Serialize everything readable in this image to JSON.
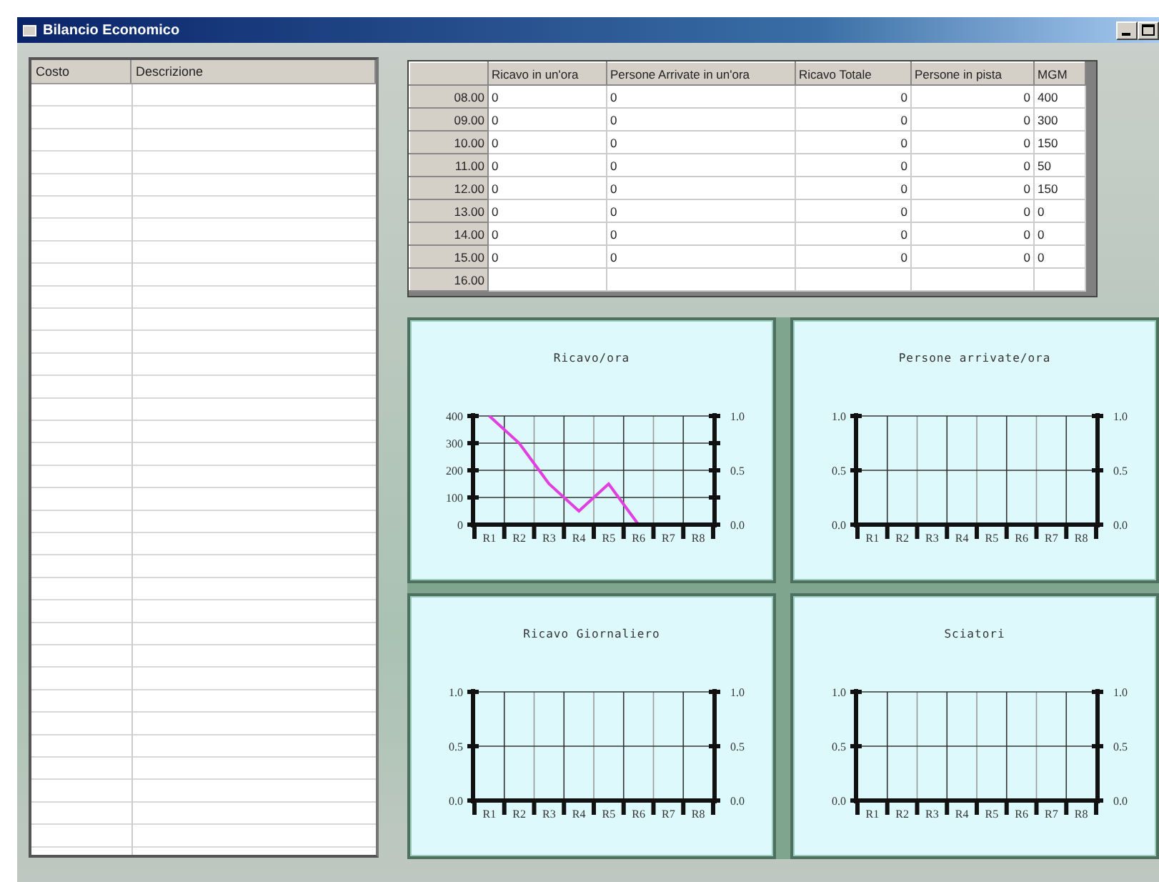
{
  "window": {
    "title": "Bilancio Economico"
  },
  "cost_table": {
    "columns": [
      "Costo",
      "Descrizione"
    ]
  },
  "hourly_table": {
    "columns": [
      "",
      "Ricavo in un'ora",
      "Persone Arrivate in un'ora",
      "Ricavo Totale",
      "Persone in pista",
      "MGM"
    ],
    "rows": [
      {
        "cells": [
          "08.00",
          "0",
          "0",
          "0",
          "0",
          "400"
        ]
      },
      {
        "cells": [
          "09.00",
          "0",
          "0",
          "0",
          "0",
          "300"
        ]
      },
      {
        "cells": [
          "10.00",
          "0",
          "0",
          "0",
          "0",
          "150"
        ]
      },
      {
        "cells": [
          "11.00",
          "0",
          "0",
          "0",
          "0",
          "50"
        ]
      },
      {
        "cells": [
          "12.00",
          "0",
          "0",
          "0",
          "0",
          "150"
        ]
      },
      {
        "cells": [
          "13.00",
          "0",
          "0",
          "0",
          "0",
          "0"
        ]
      },
      {
        "cells": [
          "14.00",
          "0",
          "0",
          "0",
          "0",
          "0"
        ]
      },
      {
        "cells": [
          "15.00",
          "0",
          "0",
          "0",
          "0",
          "0"
        ]
      },
      {
        "cells": [
          "16.00"
        ]
      }
    ]
  },
  "charts": [
    {
      "right_axis": [
        "1.0",
        "0.5",
        "0.0"
      ],
      "chart_data": {
        "type": "line",
        "title": "Ricavo/ora",
        "grid": true,
        "categories": [
          "R1",
          "R2",
          "R3",
          "R4",
          "R5",
          "R6",
          "R7",
          "R8"
        ],
        "ylim": [
          0,
          400
        ],
        "yticks": [
          0,
          100,
          200,
          300,
          400
        ],
        "series": [
          {
            "color": "#e040e0",
            "values": [
              400,
              300,
              150,
              50,
              150,
              0,
              null,
              null
            ]
          }
        ]
      }
    },
    {
      "right_axis": [
        "1.0",
        "0.5",
        "0.0"
      ],
      "chart_data": {
        "type": "line",
        "title": "Persone arrivate/ora",
        "grid": true,
        "categories": [
          "R1",
          "R2",
          "R3",
          "R4",
          "R5",
          "R6",
          "R7",
          "R8"
        ],
        "ylim": [
          0,
          1
        ],
        "yticks": [
          {
            "value": 0,
            "label": "0.0"
          },
          {
            "value": 0.5,
            "label": "0.5"
          },
          {
            "value": 1,
            "label": "1.0"
          }
        ]
      }
    },
    {
      "right_axis": [
        "1.0",
        "0.5",
        "0.0"
      ],
      "chart_data": {
        "type": "line",
        "title": "Ricavo Giornaliero",
        "grid": true,
        "categories": [
          "R1",
          "R2",
          "R3",
          "R4",
          "R5",
          "R6",
          "R7",
          "R8"
        ],
        "ylim": [
          0,
          1
        ],
        "yticks": [
          {
            "value": 0,
            "label": "0.0"
          },
          {
            "value": 0.5,
            "label": "0.5"
          },
          {
            "value": 1,
            "label": "1.0"
          }
        ]
      }
    },
    {
      "right_axis": [
        "1.0",
        "0.5",
        "0.0"
      ],
      "chart_data": {
        "type": "line",
        "title": "Sciatori",
        "grid": true,
        "categories": [
          "R1",
          "R2",
          "R3",
          "R4",
          "R5",
          "R6",
          "R7",
          "R8"
        ],
        "ylim": [
          0,
          1
        ],
        "yticks": [
          {
            "value": 0,
            "label": "0.0"
          },
          {
            "value": 0.5,
            "label": "0.5"
          },
          {
            "value": 1,
            "label": "1.0"
          }
        ]
      }
    }
  ]
}
